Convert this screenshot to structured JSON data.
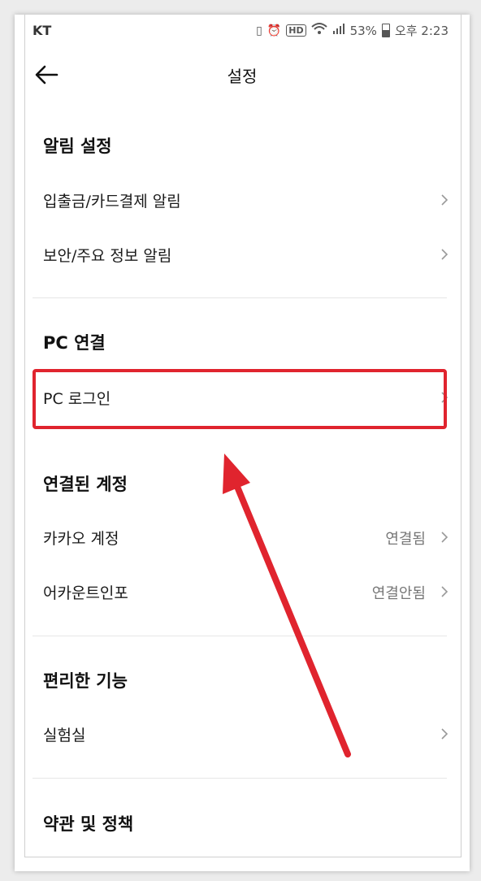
{
  "status_bar": {
    "carrier": "KT",
    "battery": "53%",
    "time": "오후 2:23",
    "icons": [
      "vibrate-icon",
      "alarm-icon",
      "hd-icon",
      "wifi-icon",
      "signal-icon",
      "battery-icon"
    ]
  },
  "header": {
    "title": "설정",
    "back_icon": "arrow-left-icon"
  },
  "sections": {
    "notifications": {
      "title": "알림 설정",
      "items": [
        {
          "label": "입출금/카드결제 알림"
        },
        {
          "label": "보안/주요 정보 알림"
        }
      ]
    },
    "pc": {
      "title": "PC 연결",
      "items": [
        {
          "label": "PC 로그인"
        }
      ]
    },
    "linked": {
      "title": "연결된 계정",
      "items": [
        {
          "label": "카카오 계정",
          "value": "연결됨"
        },
        {
          "label": "어카운트인포",
          "value": "연결안됨"
        }
      ]
    },
    "convenience": {
      "title": "편리한 기능",
      "items": [
        {
          "label": "실험실"
        }
      ]
    },
    "terms": {
      "title": "약관 및 정책"
    }
  },
  "annotation": {
    "highlight_color": "#e0242e",
    "target": "PC 로그인"
  }
}
